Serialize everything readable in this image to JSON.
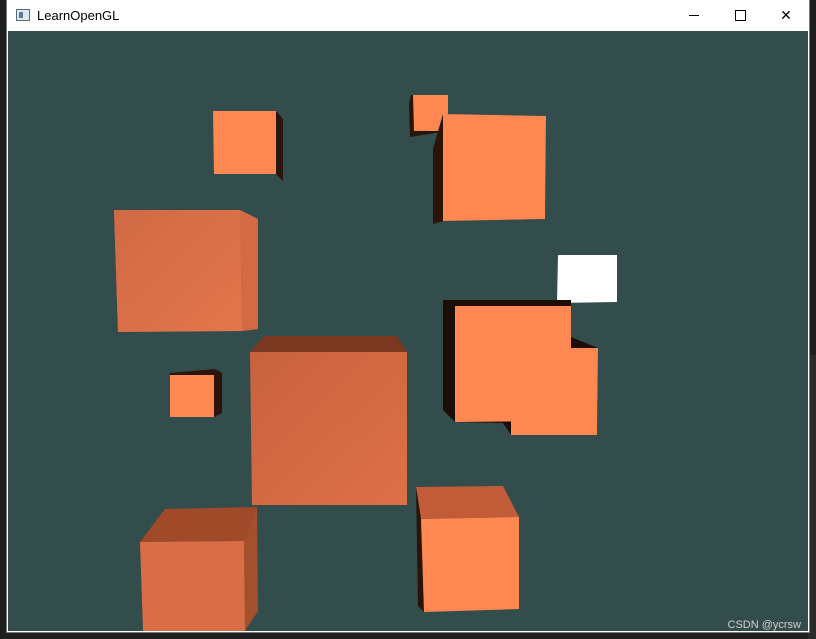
{
  "window": {
    "title": "LearnOpenGL",
    "icon": "window-app-icon"
  },
  "controls": {
    "minimize_icon": "minimize-icon",
    "maximize_icon": "maximize-icon",
    "close_icon": "close-icon",
    "close_glyph": "✕"
  },
  "scene": {
    "background": "#334d4d",
    "cube_color": "#ff8752",
    "light_color": "#ffffff"
  },
  "watermark": "CSDN @ycrsw"
}
